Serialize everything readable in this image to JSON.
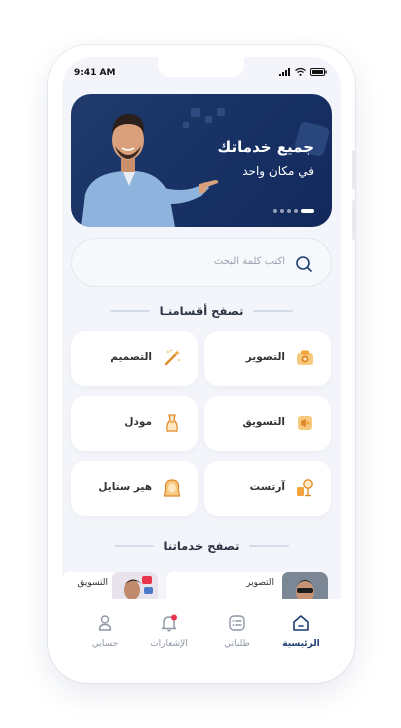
{
  "status_bar": {
    "time": "9:41 AM"
  },
  "banner": {
    "title": "جميع خدماتك",
    "subtitle": "في مكان واحد",
    "dots_count": 5,
    "active_dot": 0,
    "background": "#1a3468"
  },
  "search": {
    "placeholder": "اكتب كلمة البحث"
  },
  "categories_section": {
    "title": "تصفح أقسامنـا"
  },
  "categories": [
    {
      "label": "التصوير",
      "icon": "camera-icon"
    },
    {
      "label": "التصميم",
      "icon": "magic-wand-icon"
    },
    {
      "label": "التسويق",
      "icon": "marketing-icon"
    },
    {
      "label": "مودل",
      "icon": "model-dress-icon"
    },
    {
      "label": "آرتست",
      "icon": "artist-mic-icon"
    },
    {
      "label": "هير ستايل",
      "icon": "hair-style-icon"
    }
  ],
  "services_section": {
    "title": "تصفح خدماتنا"
  },
  "services": [
    {
      "label": "التصوير"
    },
    {
      "label": "التسويق"
    }
  ],
  "bottom_nav": {
    "items": [
      {
        "label": "الرئيسية",
        "icon": "home-icon",
        "active": true
      },
      {
        "label": "طلباتي",
        "icon": "orders-icon",
        "active": false
      },
      {
        "label": "الإشعارات",
        "icon": "bell-icon",
        "active": false
      },
      {
        "label": "حسابي",
        "icon": "user-icon",
        "active": false
      }
    ]
  },
  "colors": {
    "primary": "#1d3d73",
    "accent": "#f2a33a",
    "notification_dot": "#e8344a",
    "screen_bg": "#f3f5fa"
  }
}
